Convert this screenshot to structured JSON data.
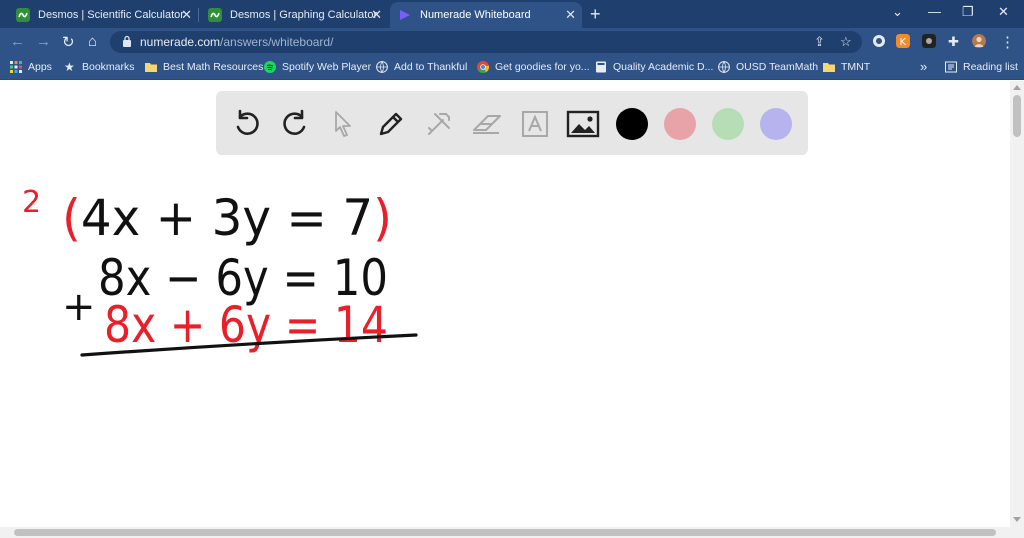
{
  "tabs": [
    {
      "label": "Desmos | Scientific Calculator",
      "active": false
    },
    {
      "label": "Desmos | Graphing Calculator",
      "active": false
    },
    {
      "label": "Numerade Whiteboard",
      "active": true
    }
  ],
  "address": {
    "host": "numerade.com",
    "path": "/answers/whiteboard/"
  },
  "bookmarks": [
    {
      "label": "Apps",
      "icon": "apps-grid-icon"
    },
    {
      "label": "Bookmarks",
      "icon": "star-icon"
    },
    {
      "label": "Best Math Resources",
      "icon": "folder-icon"
    },
    {
      "label": "Spotify Web Player",
      "icon": "spotify-icon"
    },
    {
      "label": "Add to Thankful",
      "icon": "globe-icon"
    },
    {
      "label": "Get goodies for yo...",
      "icon": "chrome-icon"
    },
    {
      "label": "Quality Academic D...",
      "icon": "page-icon"
    },
    {
      "label": "OUSD TeamMath",
      "icon": "globe-icon"
    },
    {
      "label": "TMNT",
      "icon": "folder-icon"
    }
  ],
  "bookmarks_overflow": "»",
  "reading_list": "Reading list",
  "toolbar": {
    "tools": [
      "undo-icon",
      "redo-icon",
      "pointer-icon",
      "pen-icon",
      "tools-icon",
      "eraser-icon",
      "text-icon",
      "image-icon"
    ],
    "colors": [
      "#000000",
      "#e8a3a8",
      "#b7ddb7",
      "#b7b3ee"
    ]
  },
  "whiteboard": {
    "multiplier": "2",
    "line1": "(4x + 3y = 7)",
    "line2": "8x − 6y = 10",
    "plus": "+",
    "line3": "8x + 6y = 14",
    "ink_black": "#111111",
    "ink_red": "#e8202a"
  }
}
